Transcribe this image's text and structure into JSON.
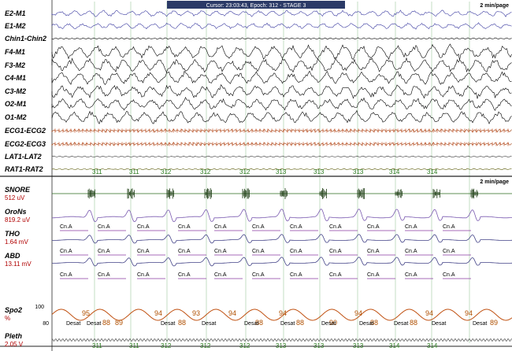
{
  "header": {
    "cursor_text": "Cursor: 23:03:43,  Epoch: 312 - STAGE 3",
    "page_scale_top": "2 min/page",
    "page_scale_bottom": "2 min/page"
  },
  "eeg_channels": [
    {
      "label": "E2-M1",
      "color": "#3a3aa0",
      "amp": 3.0,
      "freq": 0.35
    },
    {
      "label": "E1-M2",
      "color": "#3a3aa0",
      "amp": 3.0,
      "freq": 0.35
    },
    {
      "label": "Chin1-Chin2",
      "color": "#000000",
      "amp": 0.8,
      "freq": 0.9
    },
    {
      "label": "F4-M1",
      "color": "#000000",
      "amp": 7.0,
      "freq": 0.28
    },
    {
      "label": "F3-M2",
      "color": "#000000",
      "amp": 7.0,
      "freq": 0.28
    },
    {
      "label": "C4-M1",
      "color": "#000000",
      "amp": 6.5,
      "freq": 0.28
    },
    {
      "label": "C3-M2",
      "color": "#000000",
      "amp": 6.5,
      "freq": 0.28
    },
    {
      "label": "O2-M1",
      "color": "#000000",
      "amp": 6.0,
      "freq": 0.28
    },
    {
      "label": "O1-M2",
      "color": "#000000",
      "amp": 6.0,
      "freq": 0.28
    },
    {
      "label": "ECG1-ECG2",
      "color": "#a04010",
      "amp": 1.5,
      "freq": 1.2
    },
    {
      "label": "ECG2-ECG3",
      "color": "#a04010",
      "amp": 1.5,
      "freq": 1.2
    },
    {
      "label": "LAT1-LAT2",
      "color": "#333333",
      "amp": 0.6,
      "freq": 0.8
    },
    {
      "label": "RAT1-RAT2",
      "color": "#555500",
      "amp": 0.6,
      "freq": 0.8
    }
  ],
  "resp_channels": [
    {
      "label": "SNORE",
      "sub": "512 uV"
    },
    {
      "label": "OroNs",
      "sub": "819.2 uV"
    },
    {
      "label": "THO",
      "sub": "1.64 mV"
    },
    {
      "label": "ABD",
      "sub": "13.11 mV"
    },
    {
      "label": "Spo2",
      "sub": "%"
    },
    {
      "label": "Pleth",
      "sub": "2.05 V"
    }
  ],
  "epoch_ticks_top": [
    "311",
    "311",
    "312",
    "312",
    "312",
    "313",
    "313",
    "313",
    "314",
    "314"
  ],
  "epoch_ticks_bottom": [
    "311",
    "311",
    "312",
    "312",
    "312",
    "313",
    "313",
    "313",
    "314",
    "314"
  ],
  "event_label": "Cn.A",
  "desat_label": "Desat",
  "spo2_axis": {
    "top": "100",
    "bottom": "80"
  },
  "spo2_values_high": [
    "95",
    "94",
    "93",
    "94",
    "94",
    "94",
    "94",
    "94"
  ],
  "spo2_values_low": [
    "88",
    "89",
    "88",
    "88",
    "88",
    "90",
    "88",
    "88",
    "89"
  ]
}
